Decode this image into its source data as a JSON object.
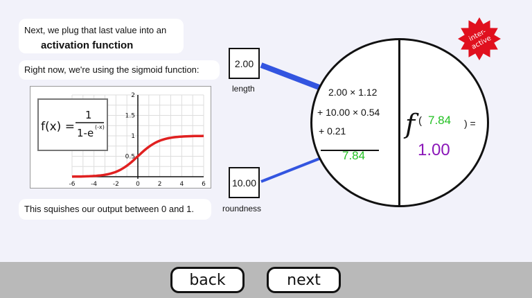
{
  "text": {
    "intro_line": "Next, we plug that last value into an",
    "intro_bold": "activation function",
    "sigmoid_note": "Right now, we're using the sigmoid function:",
    "squish_note": "This squishes our output between 0 and 1."
  },
  "sigmoid_plot": {
    "formula_fx": "f(x) =",
    "formula_num": "1",
    "formula_den": "1-e",
    "formula_exp": "(-x)",
    "x_ticks": [
      "-6",
      "-4",
      "-2",
      "0",
      "2",
      "4",
      "6"
    ],
    "y_ticks": [
      "2",
      "1.5",
      "1",
      "0.5"
    ],
    "xlim": [
      -6,
      6
    ],
    "ylim": [
      0,
      2
    ],
    "curve_color": "#e02020"
  },
  "inputs": {
    "length_value": "2.00",
    "length_label": "length",
    "roundness_value": "10.00",
    "roundness_label": "roundness"
  },
  "neuron": {
    "line1": "2.00 × 1.12",
    "line2": "+ 10.00 × 0.54",
    "line3": "+ 0.21",
    "sum": "7.84",
    "f_symbol": "f",
    "f_input": "7.84",
    "f_close": ") =",
    "output": "1.00",
    "sum_color": "#22c022",
    "output_color": "#8a16b8"
  },
  "badge": {
    "line1": "inter-",
    "line2": "active",
    "color": "#e0101e"
  },
  "nav": {
    "back_label": "back",
    "next_label": "next"
  }
}
